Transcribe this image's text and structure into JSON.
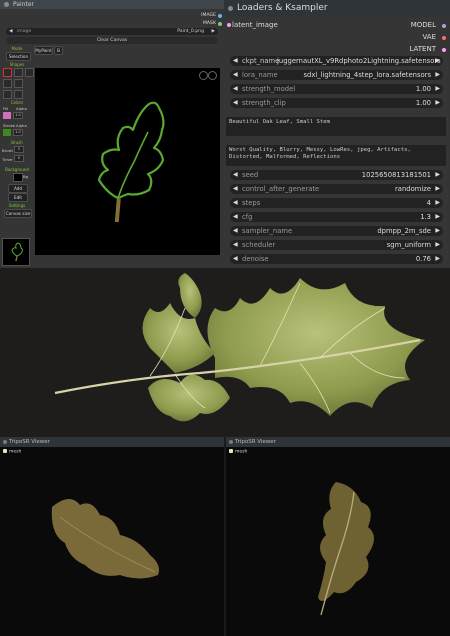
{
  "painter": {
    "title": "Painter",
    "outputs": [
      "IMAGE",
      "MASK"
    ],
    "image_widget": {
      "label": "image",
      "value": "Paint_0.png"
    },
    "clear_canvas": "Clear Canvas",
    "mode_label": "Mode",
    "mode_value": "Selection",
    "mypaint_label": "MyPaint",
    "shapes_label": "Shapes",
    "colors_label": "Colors",
    "fill_label": "Fill",
    "alpha_label": "Alpha",
    "fill_alpha_value": "1.0",
    "stroke_label": "Stroke",
    "stroke_alpha_value": "1.0",
    "brush_label": "Brush",
    "brush_size_label": "Brush",
    "brush_size_value": "5",
    "timer_label": "Timer",
    "timer_value": "0",
    "background_label": "Background",
    "background_extra": "Bg",
    "settings_label": "Settings",
    "add_label": "Add",
    "edit_label": "Edit",
    "canvas_size_label": "Canvas size",
    "colors": {
      "accent": "#7ec832",
      "stroke": "#5aa832"
    }
  },
  "loader": {
    "title": "Loaders & Ksampler",
    "input_label": "latent_image",
    "outputs": [
      {
        "label": "MODEL",
        "color": "#b39ddb"
      },
      {
        "label": "VAE",
        "color": "#ff6e6e"
      },
      {
        "label": "LATENT",
        "color": "#ff9cf9"
      }
    ],
    "ckpt": {
      "label": "ckpt_name",
      "value": "juggernautXL_v9Rdphoto2Lightning.safetensors"
    },
    "lora": {
      "label": "lora_name",
      "value": "sdxl_lightning_4step_lora.safetensors"
    },
    "strength_model": {
      "label": "strength_model",
      "value": "1.00"
    },
    "strength_clip": {
      "label": "strength_clip",
      "value": "1.00"
    },
    "positive_prompt": "Beautiful Oak Leaf, Small Stem",
    "negative_prompt": "Worst Quality, Blurry, Messy, LowRes, jpeg, Artifacts, Distorted, Malformed, Reflections",
    "seed": {
      "label": "seed",
      "value": "1025650813181501"
    },
    "control": {
      "label": "control_after_generate",
      "value": "randomize"
    },
    "steps": {
      "label": "steps",
      "value": "4"
    },
    "cfg": {
      "label": "cfg",
      "value": "1.3"
    },
    "sampler": {
      "label": "sampler_name",
      "value": "dpmpp_2m_sde"
    },
    "scheduler": {
      "label": "scheduler",
      "value": "sgm_uniform"
    },
    "denoise": {
      "label": "denoise",
      "value": "0.76"
    }
  },
  "viewers": [
    {
      "title": "TripoSR Viewer",
      "legend": "mesh"
    },
    {
      "title": "TripoSR Viewer",
      "legend": "mesh"
    }
  ]
}
